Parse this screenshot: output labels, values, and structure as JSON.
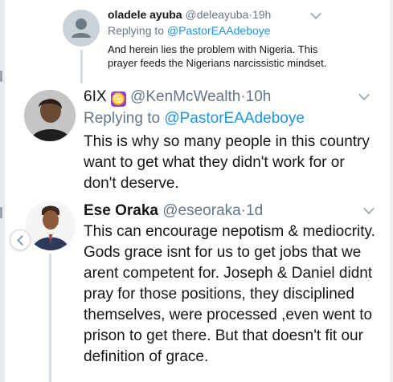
{
  "tweets": [
    {
      "name": "oladele ayuba",
      "handle": "@deleayuba",
      "time": "19h",
      "reply_prefix": "Replying to",
      "reply_to": "@PastorEAAdeboye",
      "text": "And herein lies the problem with Nigeria. This prayer feeds the Nigerians narcissistic mindset."
    },
    {
      "name": "6IX",
      "badge": "♋",
      "handle": "@KenMcWealth",
      "time": "10h",
      "reply_prefix": "Replying to",
      "reply_to": "@PastorEAAdeboye",
      "text": "This is why so many people in this country want to get what they didn't work for or don't deserve."
    },
    {
      "name": "Ese Oraka",
      "handle": "@eseoraka",
      "time": "1d",
      "text": "This can encourage nepotism & mediocrity. Gods grace isnt for us to get jobs that we arent competent for. Joseph & Daniel didnt pray for those positions, they disciplined themselves, were processed ,even went to prison to get there. But that doesn't fit our definition of grace."
    }
  ],
  "separator": "·",
  "colors": {
    "link": "#1d95e0",
    "muted": "#657786",
    "text": "#14171a",
    "thread_line": "#d5dde3"
  }
}
